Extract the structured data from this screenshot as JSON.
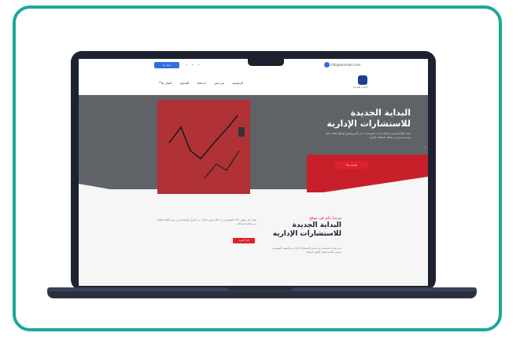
{
  "topbar": {
    "button_label": "اتصل بنا",
    "dots": "• • •",
    "email": "info@example.com"
  },
  "nav": {
    "items": [
      "الرئيسية",
      "من نحن",
      "خدماتنا",
      "المدونة",
      "اتصل بنا"
    ],
    "logo_text": "البداية الجديدة"
  },
  "hero": {
    "title": "البداية الجديدة للاستشارات الإدارية",
    "subtitle": "نقدم حلولاً استشارية متكاملة تساعد المؤسسات على النمو وتحقيق أهدافها بكفاءة عالية وخبرة متميزة في مختلف المجالات الإدارية",
    "cta_label": "تواصل معنا"
  },
  "about": {
    "kicker": "مرحبا بكم في موقع",
    "title": "البداية الجديدة للاستشارات الإدارية",
    "text": "نحن شركة متخصصة في تقديم الاستشارات الإدارية والتطوير المؤسسي ونسعى لتقديم أفضل الحلول لعملائنا",
    "left_text": "نعمل على تطوير الأداء المؤسسي من خلال فريق متكامل من الخبراء والمستشارين ذوي الكفاءة العالية في مختلف المجالات",
    "button_label": "اقرأ المزيد"
  }
}
